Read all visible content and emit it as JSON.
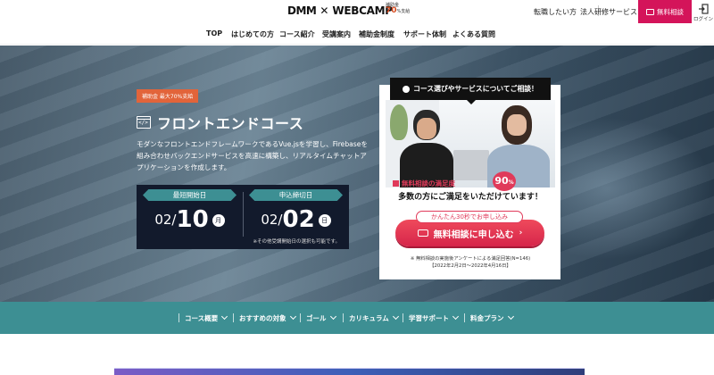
{
  "header": {
    "logo_dmm": "DMM",
    "logo_x": "✕",
    "logo_webcamp": "WEBCAMP",
    "logo_badge_top": "補助金",
    "logo_badge_big": "70",
    "logo_badge_bottom": "%支給",
    "link_career": "転職したい方",
    "link_corporate": "法人研修サービス",
    "consult_label": "無料相談",
    "login_label": "ログイン"
  },
  "nav": {
    "items": [
      "TOP",
      "はじめての方",
      "コース紹介",
      "受講案内",
      "補助金制度",
      "サポート体制",
      "よくある質問"
    ]
  },
  "hero": {
    "badge": "補助金 最大70%支給",
    "title": "フロントエンドコース",
    "description": "モダンなフロントエンドフレームワークであるVue.jsを学習し、Firebaseを組み合わせバックエンドサービスを高速に構築し、リアルタイムチャットアプリケーションを作成します。",
    "dates": {
      "start_label": "最短開始日",
      "start_month": "02",
      "start_day": "10",
      "start_dow": "月",
      "deadline_label": "申込締切日",
      "deadline_month": "02",
      "deadline_day": "02",
      "deadline_dow": "日",
      "note": "※その他受講開始日の選択も可能です。"
    }
  },
  "consult_card": {
    "tab_label": "コース選びやサービスについてご相談！",
    "satisfaction_label": "無料相談の満足度",
    "satisfaction_value": "90",
    "satisfaction_unit": "%",
    "headline": "多数の方にご満足をいただけています！",
    "easy_label": "かんたん30秒でお申し込み",
    "button_label": "無料相談に申し込む",
    "note_line1": "※ 無料相談の実施後アンケートによる満足回答(N=146)",
    "note_line2": "【2022年2月2日〜2022年4月16日】"
  },
  "section_nav": {
    "items": [
      "コース概要",
      "おすすめの対象",
      "ゴール",
      "カリキュラム",
      "学習サポート",
      "料金プラン"
    ]
  },
  "colors": {
    "accent_pink": "#d4145a",
    "teal": "#3d8f93",
    "navy": "#121a2c",
    "orange_badge": "#e2643a"
  }
}
